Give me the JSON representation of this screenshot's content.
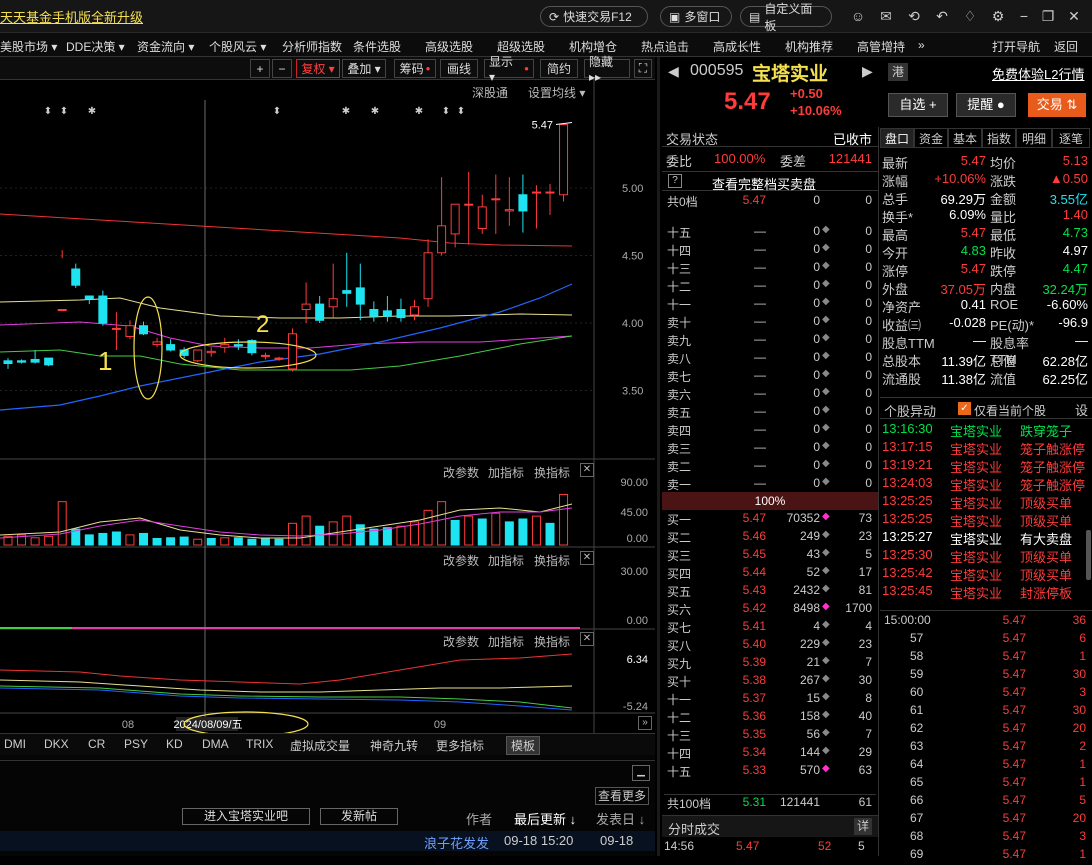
{
  "topbar": {
    "promo": "天天基金手机版全新升级",
    "quick_trade": "快速交易F12",
    "multi_window": "多窗口",
    "custom_panel": "自定义面板"
  },
  "nav": [
    "美股市场 ▾",
    "DDE决策 ▾",
    "资金流向 ▾",
    "个股风云 ▾",
    "分析师指数",
    "条件选股",
    "高级选股",
    "超级选股",
    "机构增仓",
    "热点追击",
    "高成长性",
    "机构推荐",
    "高管增持",
    "»",
    "打开导航",
    "返回"
  ],
  "chart_toolbar": {
    "plus": "+",
    "minus": "−",
    "fuquan": "复权 ▾",
    "diejia": "叠加 ▾",
    "chouma": "筹码",
    "huaxian": "画线",
    "xianshi": "显示 ▾",
    "jianyue": "简约",
    "yincang": "隐藏 ▸▸"
  },
  "chart_header": {
    "shentong": "深股通",
    "ma_setting": "设置均线 ▾"
  },
  "chart_data": {
    "type": "candlestick",
    "y_ticks": [
      "5.00",
      "4.50",
      "4.00",
      "3.50"
    ],
    "last_price_label": "5.47",
    "x_labels": [
      "08",
      "09"
    ],
    "cursor_date": "2024/08/09/五",
    "annotations": [
      "1",
      "2"
    ],
    "volume_ticks": [
      "90.00",
      "45.00",
      "0.00"
    ],
    "ind2_ticks": [
      "30.00",
      "0.00"
    ],
    "ind3_ticks": [
      "6.34",
      "-5.24"
    ],
    "candles": [
      [
        3.72,
        3.74,
        3.7,
        3.66
      ],
      [
        3.72,
        3.73,
        3.71,
        3.7
      ],
      [
        3.73,
        3.8,
        3.71,
        3.7
      ],
      [
        3.74,
        3.74,
        3.69,
        3.68
      ],
      [
        4.1,
        4.54,
        4.1,
        4.48
      ],
      [
        4.4,
        4.44,
        4.28,
        4.26
      ],
      [
        4.2,
        4.2,
        4.18,
        4.14
      ],
      [
        4.2,
        4.24,
        4.0,
        3.98
      ],
      [
        3.96,
        4.08,
        3.96,
        3.8
      ],
      [
        3.9,
        4.02,
        3.98,
        3.88
      ],
      [
        3.98,
        4.01,
        3.92,
        3.91
      ],
      [
        3.84,
        3.89,
        3.86,
        3.82
      ],
      [
        3.84,
        3.88,
        3.8,
        3.79
      ],
      [
        3.8,
        3.82,
        3.76,
        3.74
      ],
      [
        3.72,
        3.78,
        3.8,
        3.71
      ],
      [
        3.78,
        3.82,
        3.79,
        3.75
      ],
      [
        3.82,
        3.89,
        3.84,
        3.78
      ],
      [
        3.84,
        3.88,
        3.83,
        3.8
      ],
      [
        3.87,
        3.88,
        3.78,
        3.76
      ],
      [
        3.76,
        3.78,
        3.76,
        3.73
      ],
      [
        3.74,
        3.75,
        3.74,
        3.72
      ],
      [
        3.66,
        3.96,
        3.92,
        3.64
      ],
      [
        4.1,
        4.3,
        4.14,
        4.0
      ],
      [
        4.14,
        4.2,
        4.02,
        4.0
      ],
      [
        4.12,
        4.44,
        4.18,
        4.04
      ],
      [
        4.24,
        4.52,
        4.22,
        4.12
      ],
      [
        4.26,
        4.44,
        4.14,
        4.02
      ],
      [
        4.1,
        4.16,
        4.05,
        4.01
      ],
      [
        4.09,
        4.2,
        4.05,
        4.01
      ],
      [
        4.1,
        4.18,
        4.04,
        4.01
      ],
      [
        4.06,
        4.17,
        4.12,
        4.02
      ],
      [
        4.18,
        4.62,
        4.52,
        4.12
      ],
      [
        4.52,
        5.08,
        4.72,
        4.5
      ],
      [
        4.66,
        4.8,
        4.88,
        4.56
      ],
      [
        4.88,
        5.12,
        4.88,
        4.58
      ],
      [
        4.7,
        4.95,
        4.86,
        4.66
      ],
      [
        4.92,
        5.1,
        4.92,
        4.66
      ],
      [
        4.83,
        5.08,
        4.84,
        4.72
      ],
      [
        4.95,
        5.1,
        4.83,
        4.67
      ],
      [
        4.97,
        5.02,
        4.97,
        4.7
      ],
      [
        4.97,
        5.03,
        4.97,
        4.8
      ],
      [
        4.95,
        5.47,
        5.47,
        4.9
      ]
    ],
    "volumes": [
      12,
      14,
      10,
      12,
      60,
      22,
      14,
      16,
      18,
      14,
      16,
      9,
      10,
      11,
      8,
      9,
      10,
      10,
      8,
      9,
      8,
      30,
      40,
      26,
      32,
      40,
      28,
      22,
      24,
      26,
      32,
      48,
      60,
      34,
      40,
      36,
      44,
      32,
      36,
      40,
      30,
      70
    ],
    "volume_colors": [
      "red",
      "red",
      "red",
      "red",
      "red",
      "cyan",
      "cyan",
      "cyan",
      "cyan",
      "red",
      "cyan",
      "cyan",
      "cyan",
      "cyan",
      "red",
      "cyan",
      "red",
      "cyan",
      "cyan",
      "cyan",
      "cyan",
      "red",
      "red",
      "cyan",
      "red",
      "red",
      "cyan",
      "cyan",
      "cyan",
      "red",
      "red",
      "red",
      "red",
      "cyan",
      "red",
      "cyan",
      "red",
      "cyan",
      "cyan",
      "red",
      "cyan",
      "red"
    ]
  },
  "sub_panel_labels": {
    "params": "改参数",
    "add_ind": "加指标",
    "switch_ind": "换指标"
  },
  "indicator_tabs": [
    "DMI",
    "DKX",
    "CR",
    "PSY",
    "KD",
    "DMA",
    "TRIX",
    "虚拟成交量",
    "神奇九转",
    "更多指标",
    "模板"
  ],
  "bottom": {
    "view_more": "查看更多",
    "enter_bar": "进入宝塔实业吧",
    "new_post": "发新帖",
    "author": "作者",
    "last_update": "最后更新 ↓",
    "publish_date": "发表日 ↓",
    "post_author": "浪子花发发",
    "post_time": "09-18 15:20",
    "post_date": "09-18"
  },
  "quote": {
    "code": "000595",
    "name": "宝塔实业",
    "price": "5.47",
    "change": "+0.50",
    "change_pct": "+10.06%",
    "promo": "免费体验L2行情",
    "port": "港",
    "self_select": "自选 +",
    "alert": "提醒 ●",
    "trade": "交易 ⇅"
  },
  "orderbook": {
    "trade_status_label": "交易状态",
    "trade_status": "已收市",
    "weibi_label": "委比",
    "weibi": "100.00%",
    "weicha_label": "委差",
    "weicha": "121441",
    "full_depth": "查看完整档买卖盘",
    "total0": {
      "label": "共0档",
      "price": "5.47",
      "vol": "0",
      "cnt": "0"
    },
    "sells": [
      {
        "label": "十五",
        "price": "—",
        "vol": "0",
        "cnt": "0"
      },
      {
        "label": "十四",
        "price": "—",
        "vol": "0",
        "cnt": "0"
      },
      {
        "label": "十三",
        "price": "—",
        "vol": "0",
        "cnt": "0"
      },
      {
        "label": "十二",
        "price": "—",
        "vol": "0",
        "cnt": "0"
      },
      {
        "label": "十一",
        "price": "—",
        "vol": "0",
        "cnt": "0"
      },
      {
        "label": "卖十",
        "price": "—",
        "vol": "0",
        "cnt": "0"
      },
      {
        "label": "卖九",
        "price": "—",
        "vol": "0",
        "cnt": "0"
      },
      {
        "label": "卖八",
        "price": "—",
        "vol": "0",
        "cnt": "0"
      },
      {
        "label": "卖七",
        "price": "—",
        "vol": "0",
        "cnt": "0"
      },
      {
        "label": "卖六",
        "price": "—",
        "vol": "0",
        "cnt": "0"
      },
      {
        "label": "卖五",
        "price": "—",
        "vol": "0",
        "cnt": "0"
      },
      {
        "label": "卖四",
        "price": "—",
        "vol": "0",
        "cnt": "0"
      },
      {
        "label": "卖三",
        "price": "—",
        "vol": "0",
        "cnt": "0"
      },
      {
        "label": "卖二",
        "price": "—",
        "vol": "0",
        "cnt": "0"
      },
      {
        "label": "卖一",
        "price": "—",
        "vol": "0",
        "cnt": "0"
      }
    ],
    "mid_pct": "100%",
    "buys": [
      {
        "label": "买一",
        "price": "5.47",
        "vol": "70352",
        "cnt": "73"
      },
      {
        "label": "买二",
        "price": "5.46",
        "vol": "249",
        "cnt": "23"
      },
      {
        "label": "买三",
        "price": "5.45",
        "vol": "43",
        "cnt": "5"
      },
      {
        "label": "买四",
        "price": "5.44",
        "vol": "52",
        "cnt": "17"
      },
      {
        "label": "买五",
        "price": "5.43",
        "vol": "2432",
        "cnt": "81"
      },
      {
        "label": "买六",
        "price": "5.42",
        "vol": "8498",
        "cnt": "1700"
      },
      {
        "label": "买七",
        "price": "5.41",
        "vol": "4",
        "cnt": "4"
      },
      {
        "label": "买八",
        "price": "5.40",
        "vol": "229",
        "cnt": "23"
      },
      {
        "label": "买九",
        "price": "5.39",
        "vol": "21",
        "cnt": "7"
      },
      {
        "label": "买十",
        "price": "5.38",
        "vol": "267",
        "cnt": "30"
      },
      {
        "label": "十一",
        "price": "5.37",
        "vol": "15",
        "cnt": "8"
      },
      {
        "label": "十二",
        "price": "5.36",
        "vol": "158",
        "cnt": "40"
      },
      {
        "label": "十三",
        "price": "5.35",
        "vol": "56",
        "cnt": "7"
      },
      {
        "label": "十四",
        "price": "5.34",
        "vol": "144",
        "cnt": "29"
      },
      {
        "label": "十五",
        "price": "5.33",
        "vol": "570",
        "cnt": "63"
      }
    ],
    "total100": {
      "label": "共100档",
      "price": "5.31",
      "vol": "121441",
      "cnt": "61"
    },
    "fenshi_label": "分时成交",
    "fenshi_detail": "详",
    "last_trade": {
      "time": "14:56",
      "price": "5.47",
      "vol": "52",
      "cnt": "5"
    }
  },
  "right_tabs": [
    "盘口",
    "资金",
    "基本",
    "指数",
    "明细",
    "逐笔"
  ],
  "stats": [
    [
      "最新",
      "5.47",
      "均价",
      "5.13"
    ],
    [
      "涨幅",
      "+10.06%",
      "涨跌",
      "▲0.50"
    ],
    [
      "总手",
      "69.29万",
      "金额",
      "3.55亿"
    ],
    [
      "换手*",
      "6.09%",
      "量比",
      "1.40"
    ],
    [
      "最高",
      "5.47",
      "最低",
      "4.73"
    ],
    [
      "今开",
      "4.83",
      "昨收",
      "4.97"
    ],
    [
      "涨停",
      "5.47",
      "跌停",
      "4.47"
    ],
    [
      "外盘",
      "37.05万",
      "内盘",
      "32.24万"
    ],
    [
      "净资产",
      "0.41",
      "ROE",
      "-6.60%"
    ],
    [
      "收益㈢",
      "-0.028",
      "PE(动)*",
      "-96.9"
    ],
    [
      "股息TTM",
      "—",
      "股息率TTM",
      "—"
    ],
    [
      "总股本",
      "11.39亿",
      "总值",
      "62.28亿"
    ],
    [
      "流通股",
      "11.38亿",
      "流值",
      "62.25亿"
    ]
  ],
  "stat_colors": [
    [
      "red",
      "red"
    ],
    [
      "red",
      "red"
    ],
    [
      "white",
      "cyan"
    ],
    [
      "white",
      "red"
    ],
    [
      "red",
      "green"
    ],
    [
      "green",
      "white"
    ],
    [
      "red",
      "green"
    ],
    [
      "red",
      "green"
    ],
    [
      "white",
      "white"
    ],
    [
      "white",
      "white"
    ],
    [
      "white",
      "white"
    ],
    [
      "white",
      "white"
    ],
    [
      "white",
      "white"
    ]
  ],
  "events_header": {
    "title": "个股异动",
    "only_current": "仅看当前个股",
    "settings": "设"
  },
  "events": [
    {
      "time": "13:16:30",
      "name": "宝塔实业",
      "type": "跌穿笼子",
      "color": "green"
    },
    {
      "time": "13:17:15",
      "name": "宝塔实业",
      "type": "笼子触涨停",
      "color": "red"
    },
    {
      "time": "13:19:21",
      "name": "宝塔实业",
      "type": "笼子触涨停",
      "color": "red"
    },
    {
      "time": "13:24:03",
      "name": "宝塔实业",
      "type": "笼子触涨停",
      "color": "red"
    },
    {
      "time": "13:25:25",
      "name": "宝塔实业",
      "type": "顶级买单",
      "color": "red"
    },
    {
      "time": "13:25:25",
      "name": "宝塔实业",
      "type": "顶级买单",
      "color": "red"
    },
    {
      "time": "13:25:27",
      "name": "宝塔实业",
      "type": "有大卖盘",
      "color": "white"
    },
    {
      "time": "13:25:30",
      "name": "宝塔实业",
      "type": "顶级买单",
      "color": "red"
    },
    {
      "time": "13:25:42",
      "name": "宝塔实业",
      "type": "顶级买单",
      "color": "red"
    },
    {
      "time": "13:25:45",
      "name": "宝塔实业",
      "type": "封涨停板",
      "color": "red"
    }
  ],
  "ticks": [
    {
      "t": "15:00:00",
      "p": "5.47",
      "q": "36"
    },
    {
      "t": "57",
      "p": "5.47",
      "q": "6"
    },
    {
      "t": "58",
      "p": "5.47",
      "q": "1"
    },
    {
      "t": "59",
      "p": "5.47",
      "q": "30"
    },
    {
      "t": "60",
      "p": "5.47",
      "q": "3"
    },
    {
      "t": "61",
      "p": "5.47",
      "q": "30"
    },
    {
      "t": "62",
      "p": "5.47",
      "q": "20"
    },
    {
      "t": "63",
      "p": "5.47",
      "q": "2"
    },
    {
      "t": "64",
      "p": "5.47",
      "q": "1"
    },
    {
      "t": "65",
      "p": "5.47",
      "q": "1"
    },
    {
      "t": "66",
      "p": "5.47",
      "q": "5"
    },
    {
      "t": "67",
      "p": "5.47",
      "q": "20"
    },
    {
      "t": "68",
      "p": "5.47",
      "q": "3"
    },
    {
      "t": "69",
      "p": "5.47",
      "q": "1"
    }
  ]
}
